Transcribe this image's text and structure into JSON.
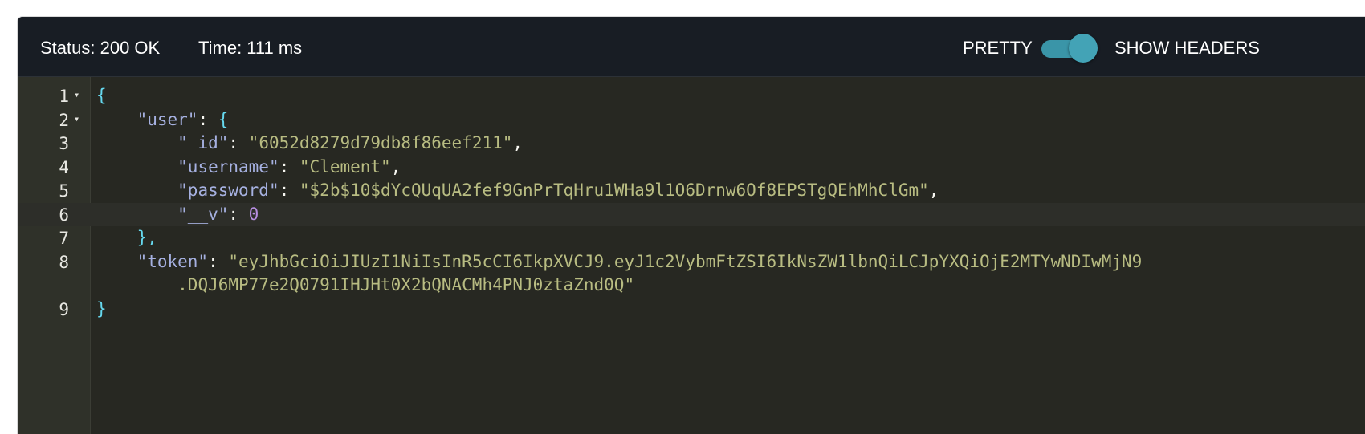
{
  "header": {
    "status": "Status: 200 OK",
    "time": "Time: 111 ms",
    "pretty_label": "PRETTY",
    "pretty_on": true,
    "show_headers_label": "SHOW HEADERS"
  },
  "editor": {
    "lines": [
      {
        "num": "1",
        "foldable": true
      },
      {
        "num": "2",
        "foldable": true
      },
      {
        "num": "3",
        "foldable": false
      },
      {
        "num": "4",
        "foldable": false
      },
      {
        "num": "5",
        "foldable": false
      },
      {
        "num": "6",
        "foldable": false
      },
      {
        "num": "7",
        "foldable": false
      },
      {
        "num": "8",
        "foldable": false
      },
      {
        "num": "9",
        "foldable": false
      }
    ],
    "fold_glyph": "▾",
    "json": {
      "open_brace": "{",
      "close_brace": "}",
      "user_key": "\"user\"",
      "user_close": "},",
      "id_key": "\"_id\"",
      "id_value": "\"6052d8279d79db8f86eef211\"",
      "username_key": "\"username\"",
      "username_value": "\"Clement\"",
      "password_key": "\"password\"",
      "password_value": "\"$2b$10$dYcQUqUA2fef9GnPrTqHru1WHa9l1O6Drnw6Of8EPSTgQEhMhClGm\"",
      "v_key": "\"__v\"",
      "v_value": "0",
      "token_key": "\"token\"",
      "token_value_line1": "\"eyJhbGciOiJIUzI1NiIsInR5cCI6IkpXVCJ9.eyJ1c2VybmFtZSI6IkNsZW1lbnQiLCJpYXQiOjE2MTYwNDIwMjN9",
      "token_value_line2": ".DQJ6MP77e2Q0791IHJHt0X2bQNACMh4PNJ0ztaZnd0Q\""
    }
  },
  "colors": {
    "header_bg": "#181d24",
    "editor_bg": "#272822",
    "toggle_accent": "#3a95a8",
    "string": "#b8bc82",
    "key": "#a6b1e1",
    "number": "#b78ee0",
    "brace": "#66d9ef"
  }
}
